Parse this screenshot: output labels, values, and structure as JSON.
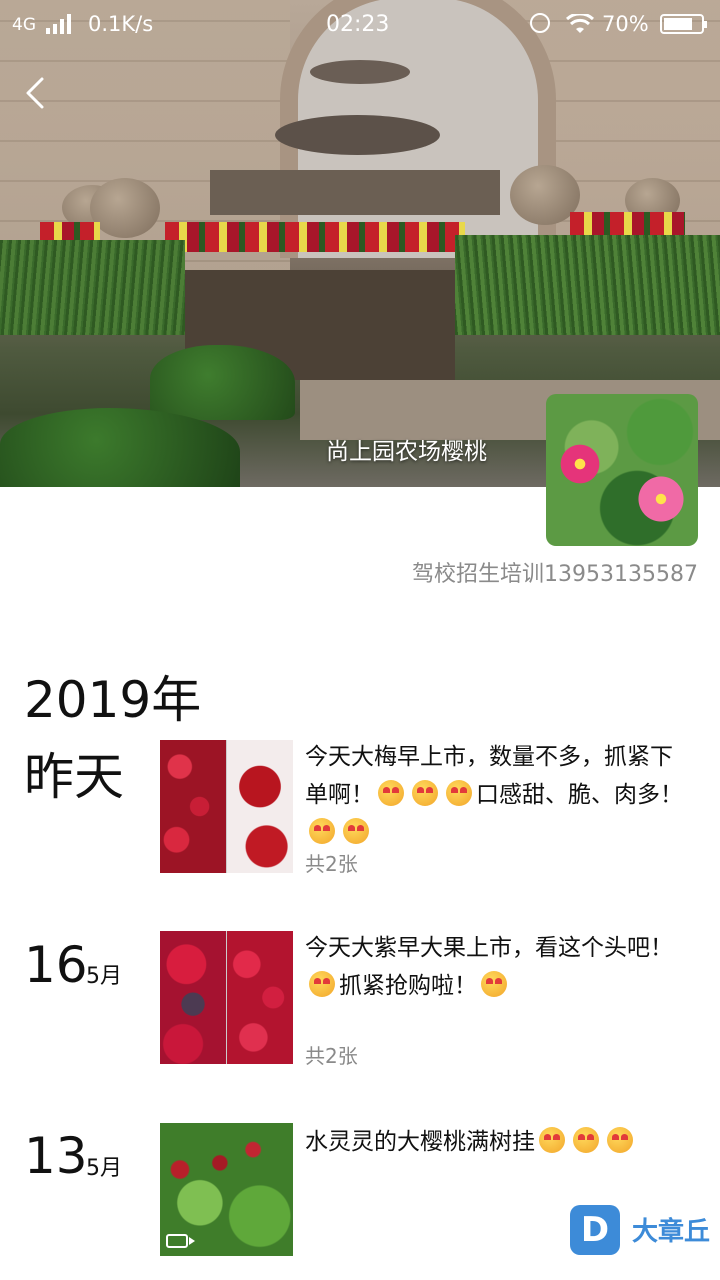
{
  "status_bar": {
    "network": "4G",
    "speed": "0.1K/s",
    "time": "02:23",
    "battery": "70%"
  },
  "cover": {
    "title": "尚上园农场樱桃"
  },
  "profile": {
    "name": "驾校招生培训13953135587"
  },
  "timeline": {
    "year": "2019年",
    "posts": [
      {
        "date_label": "昨天",
        "text": "今天大梅早上市，数量不多，抓紧下单啊！",
        "text_after": "口感甜、脆、肉多！",
        "count": "共2张"
      },
      {
        "day": "16",
        "month": "5月",
        "text": "今天大紫早大果上市，看这个头吧！",
        "text_after": "抓紧抢购啦！",
        "count": "共2张"
      },
      {
        "day": "13",
        "month": "5月",
        "text": "水灵灵的大樱桃满树挂"
      }
    ]
  },
  "watermark": {
    "logo_letter": "D",
    "text": "大章丘"
  },
  "colors": {
    "muted_text": "#8a8a8a",
    "watermark_blue": "#3d8bd8"
  }
}
